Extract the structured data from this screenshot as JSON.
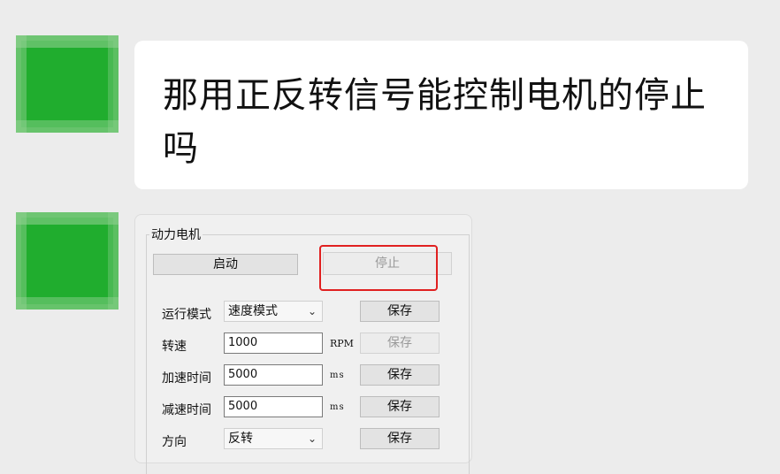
{
  "chat": {
    "message_text": "那用正反转信号能控制电机的停止吗"
  },
  "panel": {
    "group_title": "动力电机",
    "start_button": "启动",
    "stop_button": "停止",
    "rows": {
      "mode": {
        "label": "运行模式",
        "value": "速度模式",
        "save": "保存"
      },
      "speed": {
        "label": "转速",
        "value": "1000",
        "unit": "RPM",
        "save": "保存"
      },
      "accel": {
        "label": "加速时间",
        "value": "5000",
        "unit": "ms",
        "save": "保存"
      },
      "decel": {
        "label": "减速时间",
        "value": "5000",
        "unit": "ms",
        "save": "保存"
      },
      "dir": {
        "label": "方向",
        "value": "反转",
        "save": "保存"
      }
    }
  },
  "colors": {
    "avatar": "#20ad2e",
    "highlight": "#e02020",
    "background": "#ececec"
  }
}
